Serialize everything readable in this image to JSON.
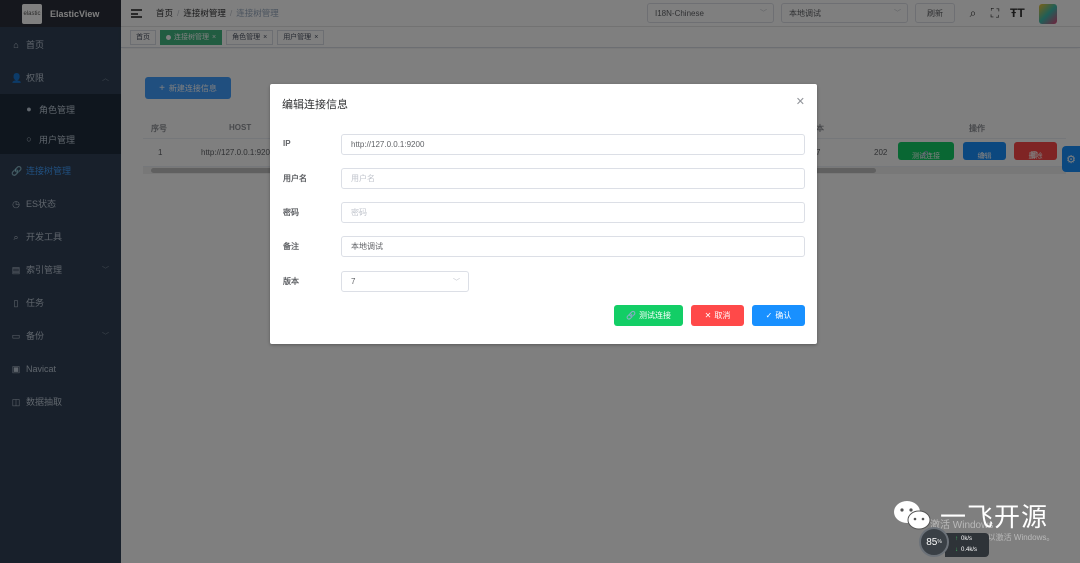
{
  "sidebar": {
    "logo_caption": "elastic",
    "logo_text": "ElasticView",
    "items": [
      {
        "label": "首页"
      },
      {
        "label": "权限"
      },
      {
        "label": "角色管理"
      },
      {
        "label": "用户管理"
      },
      {
        "label": "连接树管理"
      },
      {
        "label": "ES状态"
      },
      {
        "label": "开发工具"
      },
      {
        "label": "索引管理"
      },
      {
        "label": "任务"
      },
      {
        "label": "备份"
      },
      {
        "label": "Navicat"
      },
      {
        "label": "数据抽取"
      }
    ]
  },
  "navbar": {
    "breadcrumb": [
      "首页",
      "连接树管理",
      "连接树管理"
    ],
    "language_select": "I18N-Chinese",
    "env_select": "本地调试",
    "refresh_label": "刷新"
  },
  "tags": [
    {
      "label": "首页"
    },
    {
      "label": "连接树管理"
    },
    {
      "label": "角色管理"
    },
    {
      "label": "用户管理"
    }
  ],
  "main": {
    "new_button_label": "新建连接信息",
    "table": {
      "headers": [
        "序号",
        "HOST",
        "本",
        "操作"
      ],
      "rows": [
        {
          "index": "1",
          "host": "http://127.0.0.1:920",
          "version": "7",
          "extra": "202"
        }
      ],
      "row_actions": {
        "test": "测试连接",
        "edit": "编辑",
        "delete": "删除"
      }
    }
  },
  "dialog": {
    "title": "编辑连接信息",
    "fields": {
      "ip": {
        "label": "IP",
        "value": "http://127.0.0.1:9200"
      },
      "username": {
        "label": "用户名",
        "placeholder": "用户名"
      },
      "password": {
        "label": "密码",
        "placeholder": "密码"
      },
      "remark": {
        "label": "备注",
        "value": "本地调试"
      },
      "version": {
        "label": "版本",
        "value": "7"
      }
    },
    "buttons": {
      "test": "测试连接",
      "cancel": "取消",
      "confirm": "确认"
    }
  },
  "overlay_watermark": {
    "brand_text": "一飞开源",
    "activate_line1": "激活 Windows",
    "activate_line2": "转到\"设置\"以激活 Windows。",
    "gauge_value": "85",
    "gauge_unit": "%",
    "upload_speed": "0k/s",
    "download_speed": "0.4k/s"
  },
  "colors": {
    "primary": "#409eff",
    "success": "#13ce66",
    "danger": "#ff4949",
    "sidebar_bg": "#304156",
    "tag_active": "#42b983"
  }
}
